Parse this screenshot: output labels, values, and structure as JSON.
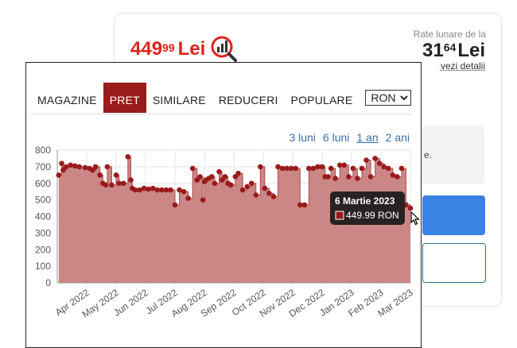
{
  "product": {
    "price_int": "449",
    "price_dec": "99",
    "price_currency": "Lei",
    "installments_label": "Rate lunare de la",
    "installment_int": "31",
    "installment_dec": "64",
    "installment_currency": "Lei",
    "details_link": "vezi detalii",
    "side_text_fragment": "e.",
    "colors": {
      "price": "#e0231b",
      "primary_button": "#3a82e4"
    }
  },
  "tabs": [
    {
      "label": "MAGAZINE",
      "active": false
    },
    {
      "label": "PRET",
      "active": true
    },
    {
      "label": "SIMILARE",
      "active": false
    },
    {
      "label": "REDUCERI",
      "active": false
    },
    {
      "label": "POPULARE",
      "active": false
    }
  ],
  "currency_select": {
    "value": "RON"
  },
  "ranges": [
    {
      "label": "3 luni",
      "active": false
    },
    {
      "label": "6 luni",
      "active": false
    },
    {
      "label": "1 an",
      "active": true
    },
    {
      "label": "2 ani",
      "active": false
    }
  ],
  "tooltip": {
    "date": "6 Martie 2023",
    "value": "449.99 RON"
  },
  "chart_data": {
    "type": "area",
    "ylim": [
      0,
      800
    ],
    "yticks": [
      "0",
      "100",
      "200",
      "300",
      "400",
      "500",
      "600",
      "700",
      "800"
    ],
    "x_range_months": [
      0,
      12
    ],
    "xticks": [
      {
        "label": "Apr 2022",
        "at": 1
      },
      {
        "label": "May 2022",
        "at": 2
      },
      {
        "label": "Jun 2022",
        "at": 3
      },
      {
        "label": "Jul 2022",
        "at": 4
      },
      {
        "label": "Aug 2022",
        "at": 5
      },
      {
        "label": "Sep 2022",
        "at": 6
      },
      {
        "label": "Oct 2022",
        "at": 7
      },
      {
        "label": "Nov 2022",
        "at": 8
      },
      {
        "label": "Dec 2022",
        "at": 9
      },
      {
        "label": "Jan 2023",
        "at": 10
      },
      {
        "label": "Feb 2023",
        "at": 11
      },
      {
        "label": "Mar 2023",
        "at": 12
      }
    ],
    "color": "#9b1a1a",
    "fill": "#c88080",
    "series": [
      {
        "x": [
          0.05,
          0.15,
          0.2,
          0.3,
          0.45,
          0.6,
          0.75,
          0.95,
          1.1,
          1.2,
          1.3,
          1.45,
          1.55,
          1.65,
          1.7,
          1.85,
          2.0,
          2.1,
          2.25,
          2.4,
          2.5,
          2.55,
          2.65,
          2.8,
          2.95,
          3.1,
          3.25,
          3.4,
          3.55,
          3.7,
          3.85,
          4.0,
          4.15,
          4.3,
          4.45,
          4.6,
          4.75,
          4.85,
          4.95,
          5.0,
          5.05,
          5.15,
          5.25,
          5.35,
          5.5,
          5.6,
          5.7,
          5.8,
          5.9,
          6.05,
          6.15,
          6.3,
          6.45,
          6.6,
          6.75,
          6.9,
          7.05,
          7.2,
          7.35,
          7.5,
          7.65,
          7.8,
          7.95,
          8.1,
          8.25,
          8.4,
          8.55,
          8.7,
          8.85,
          9.0,
          9.1,
          9.2,
          9.3,
          9.45,
          9.6,
          9.75,
          9.9,
          10.05,
          10.2,
          10.35,
          10.5,
          10.65,
          10.8,
          10.95,
          11.1,
          11.25,
          11.4,
          11.55,
          11.7,
          11.85,
          12.0
        ],
        "y": [
          650,
          720,
          680,
          700,
          710,
          705,
          700,
          695,
          690,
          680,
          700,
          650,
          600,
          590,
          700,
          590,
          650,
          600,
          600,
          760,
          620,
          570,
          560,
          560,
          570,
          565,
          570,
          560,
          560,
          560,
          560,
          470,
          560,
          550,
          510,
          690,
          620,
          640,
          500,
          610,
          620,
          630,
          640,
          600,
          670,
          620,
          640,
          600,
          590,
          640,
          660,
          560,
          580,
          600,
          530,
          700,
          570,
          540,
          520,
          700,
          690,
          690,
          690,
          690,
          470,
          470,
          690,
          690,
          700,
          700,
          640,
          640,
          690,
          630,
          710,
          710,
          640,
          690,
          630,
          690,
          740,
          640,
          750,
          720,
          700,
          690,
          650,
          640,
          690,
          470,
          450
        ]
      }
    ]
  }
}
